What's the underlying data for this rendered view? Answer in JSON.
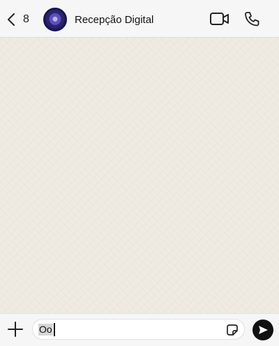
{
  "header": {
    "back_count": "8",
    "title": "Recepção Digital",
    "icons": {
      "back": "chevron-left-icon",
      "avatar": "avatar",
      "video": "video-camera-icon",
      "call": "phone-icon"
    }
  },
  "composer": {
    "input_value": "Oo",
    "icons": {
      "plus": "plus-icon",
      "sticker": "sticker-icon",
      "send": "send-icon"
    }
  },
  "colors": {
    "header_bg": "#f6f6f6",
    "chat_bg": "#efebe3",
    "send_button": "#111111",
    "avatar": "#2a2370"
  }
}
